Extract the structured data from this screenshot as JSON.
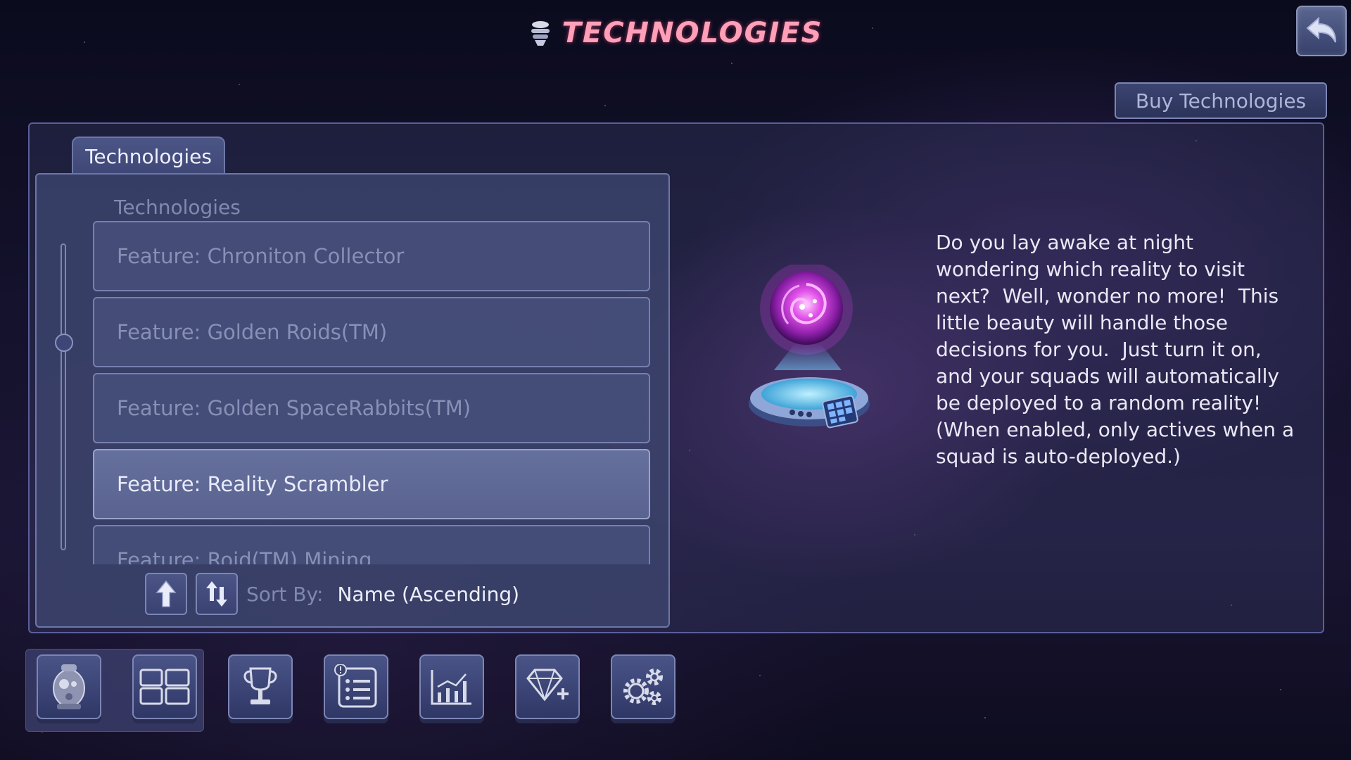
{
  "header": {
    "title": "TECHNOLOGIES",
    "buy_button_label": "Buy Technologies",
    "title_color": "#ff9fb8"
  },
  "tab": {
    "label": "Technologies"
  },
  "list": {
    "heading": "Technologies",
    "items": [
      {
        "label": "Feature: Chroniton Collector",
        "selected": false
      },
      {
        "label": "Feature: Golden Roids(TM)",
        "selected": false
      },
      {
        "label": "Feature: Golden SpaceRabbits(TM)",
        "selected": false
      },
      {
        "label": "Feature: Reality Scrambler",
        "selected": true
      },
      {
        "label": "Feature: Roid(TM) Mining",
        "selected": false
      }
    ]
  },
  "sort": {
    "label": "Sort By:",
    "value": "Name (Ascending)"
  },
  "detail": {
    "description": "Do you lay awake at night wondering which reality to visit next?  Well, wonder no more!  This little beauty will handle those decisions for you.  Just turn it on, and your squads will automatically be deployed to a random reality!  (When enabled, only actives when a squad is auto-deployed.)",
    "image_icon": "portal-hologram-icon"
  },
  "bottom_nav": [
    {
      "icon": "robot-icon"
    },
    {
      "icon": "panels-icon"
    },
    {
      "icon": "trophy-icon"
    },
    {
      "icon": "list-icon"
    },
    {
      "icon": "stats-icon"
    },
    {
      "icon": "gem-plus-icon"
    },
    {
      "icon": "settings-icon"
    }
  ]
}
